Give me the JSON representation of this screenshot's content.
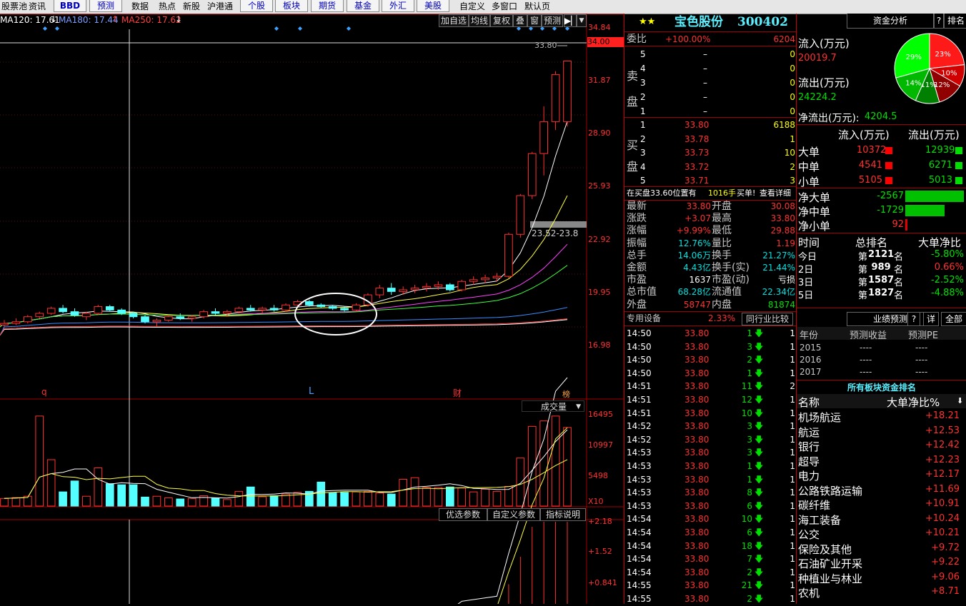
{
  "menu": {
    "items": [
      "股票池",
      "资讯"
    ],
    "tabs_blue": [
      "BBD",
      "预测"
    ],
    "items2": [
      "数据",
      "热点",
      "新股",
      "沪港通"
    ],
    "tabs2": [
      "个股",
      "板块",
      "期货",
      "基金",
      "外汇",
      "美股"
    ],
    "items3": [
      "自定义",
      "多窗口",
      "默认页"
    ]
  },
  "ma_labels": [
    {
      "text": "MA120: 17.61",
      "arrow": "↓",
      "color": "#ffffff"
    },
    {
      "text": "MA180: 17.44",
      "arrow": "↑",
      "color": "#7a9cff"
    },
    {
      "text": "MA250: 17.62",
      "arrow": "↓",
      "color": "#ff4040"
    }
  ],
  "toolbar": [
    "加自选",
    "均线",
    "复权",
    "叠",
    "窗",
    "预测"
  ],
  "price_axis": [
    "34.84",
    "34.00",
    "31.87",
    "28.90",
    "25.93",
    "22.92",
    "19.95",
    "16.98"
  ],
  "price_annot": {
    "high": "33.80",
    "range": "23.52-23.8"
  },
  "markers": {
    "q": "q",
    "L": "L",
    "cai": "财",
    "bang": "榜"
  },
  "volume": {
    "title": "成交量",
    "axis": [
      "16495",
      "10997",
      "5498",
      "X10"
    ]
  },
  "indicator": {
    "buttons": [
      "优选参数",
      "自定义参数",
      "指标说明"
    ],
    "axis": [
      "+2.18",
      "+1.52",
      "+0.841"
    ]
  },
  "chart_data": {
    "type": "candlestick",
    "price": {
      "ylim": [
        16.0,
        34.84
      ]
    },
    "candles": [
      [
        18.1,
        18.4,
        18.0,
        18.2
      ],
      [
        18.2,
        18.5,
        18.1,
        18.3
      ],
      [
        18.3,
        18.7,
        18.2,
        18.6
      ],
      [
        18.6,
        18.9,
        18.5,
        18.8
      ],
      [
        18.8,
        19.2,
        18.7,
        19.1
      ],
      [
        19.1,
        19.3,
        18.8,
        18.9
      ],
      [
        18.9,
        19.1,
        18.6,
        18.7
      ],
      [
        18.6,
        18.9,
        18.4,
        18.8
      ],
      [
        18.8,
        19.3,
        18.7,
        19.2
      ],
      [
        19.2,
        19.3,
        18.9,
        19.0
      ],
      [
        19.0,
        19.1,
        18.7,
        18.8
      ],
      [
        18.8,
        18.9,
        18.5,
        18.6
      ],
      [
        18.6,
        18.7,
        18.2,
        18.3
      ],
      [
        18.3,
        18.5,
        18.0,
        18.4
      ],
      [
        18.4,
        18.7,
        18.3,
        18.6
      ],
      [
        18.6,
        18.8,
        18.4,
        18.5
      ],
      [
        18.5,
        18.7,
        18.3,
        18.6
      ],
      [
        18.6,
        19.0,
        18.5,
        18.9
      ],
      [
        18.9,
        19.1,
        18.7,
        18.8
      ],
      [
        18.8,
        19.0,
        18.6,
        18.9
      ],
      [
        18.9,
        19.2,
        18.8,
        19.1
      ],
      [
        19.1,
        19.3,
        18.9,
        19.0
      ],
      [
        19.0,
        19.2,
        18.8,
        19.1
      ],
      [
        19.1,
        19.3,
        18.9,
        19.0
      ],
      [
        19.0,
        19.4,
        18.9,
        19.3
      ],
      [
        19.3,
        19.6,
        19.2,
        19.5
      ],
      [
        19.5,
        19.6,
        19.2,
        19.3
      ],
      [
        19.3,
        19.4,
        19.1,
        19.2
      ],
      [
        19.2,
        19.3,
        19.0,
        19.1
      ],
      [
        19.1,
        19.2,
        18.9,
        19.0
      ],
      [
        19.0,
        19.4,
        18.9,
        19.3
      ],
      [
        19.3,
        20.0,
        19.2,
        19.9
      ],
      [
        19.9,
        20.5,
        19.7,
        20.3
      ],
      [
        20.3,
        20.6,
        19.9,
        20.1
      ],
      [
        20.1,
        20.4,
        19.9,
        20.2
      ],
      [
        20.2,
        20.5,
        20.0,
        20.3
      ],
      [
        20.3,
        20.6,
        20.1,
        20.4
      ],
      [
        20.4,
        20.7,
        20.2,
        20.5
      ],
      [
        20.5,
        20.6,
        20.1,
        20.2
      ],
      [
        20.2,
        20.8,
        20.1,
        20.7
      ],
      [
        20.7,
        21.0,
        20.5,
        20.8
      ],
      [
        20.8,
        21.1,
        20.6,
        20.9
      ],
      [
        20.9,
        21.2,
        20.7,
        21.0
      ],
      [
        21.0,
        23.6,
        20.9,
        23.5
      ],
      [
        23.5,
        25.9,
        23.3,
        25.8
      ],
      [
        25.8,
        28.4,
        25.6,
        28.3
      ],
      [
        28.3,
        31.1,
        27.0,
        30.2
      ],
      [
        30.2,
        33.2,
        29.7,
        33.0
      ],
      [
        30.2,
        33.8,
        29.9,
        33.8
      ]
    ],
    "volumes": [
      1400,
      1550,
      1800,
      16495,
      8500,
      2600,
      4600,
      1800,
      7000,
      4100,
      3900,
      3900,
      1650,
      1800,
      1500,
      1300,
      1400,
      1900,
      1500,
      1200,
      2700,
      3500,
      1700,
      1900,
      2200,
      2500,
      2700,
      4400,
      2400,
      2500,
      2600,
      2700,
      2400,
      2200,
      4900,
      5200,
      3400,
      3400,
      3500,
      3300,
      2600,
      3100,
      2700,
      3600,
      8800,
      14600,
      15600,
      16495,
      14400
    ],
    "vol_ylim": [
      0,
      17000
    ]
  },
  "quote": {
    "star": "★★",
    "name": "宝色股份",
    "code": "300402",
    "weibi_label": "委比",
    "weibi_pct": "+100.00%",
    "weibi_val": "6204",
    "sell_label": "卖盘",
    "buy_label": "买盘",
    "sell": [
      {
        "n": "5",
        "p": "–",
        "v": "0"
      },
      {
        "n": "4",
        "p": "–",
        "v": "0"
      },
      {
        "n": "3",
        "p": "–",
        "v": "0"
      },
      {
        "n": "2",
        "p": "–",
        "v": "0"
      },
      {
        "n": "1",
        "p": "–",
        "v": "0"
      }
    ],
    "buy": [
      {
        "n": "1",
        "p": "33.80",
        "v": "6188"
      },
      {
        "n": "2",
        "p": "33.78",
        "v": "1"
      },
      {
        "n": "3",
        "p": "33.73",
        "v": "10"
      },
      {
        "n": "4",
        "p": "33.72",
        "v": "2"
      },
      {
        "n": "5",
        "p": "33.71",
        "v": "3"
      }
    ],
    "notice_a": "在买盘33.60位置有",
    "notice_b": "1016手",
    "notice_c": "买单!",
    "notice_d": "查看详细",
    "stats": [
      {
        "l": "最新",
        "v": "33.80",
        "vc": "red",
        "l2": "开盘",
        "v2": "30.08",
        "v2c": "red"
      },
      {
        "l": "涨跌",
        "v": "+3.07",
        "vc": "red",
        "l2": "最高",
        "v2": "33.80",
        "v2c": "red"
      },
      {
        "l": "涨幅",
        "v": "+9.99%",
        "vc": "red",
        "l2": "最低",
        "v2": "29.88",
        "v2c": "red"
      },
      {
        "l": "振幅",
        "v": "12.76%",
        "vc": "cyn",
        "l2": "量比",
        "v2": "1.19",
        "v2c": "red"
      },
      {
        "l": "总手",
        "v": "14.06万",
        "vc": "cyn",
        "l2": "换手",
        "v2": "21.27%",
        "v2c": "cyn"
      },
      {
        "l": "金额",
        "v": "4.43亿",
        "vc": "cyn",
        "l2": "换手(实)",
        "v2": "21.44%",
        "v2c": "cyn"
      },
      {
        "l": "市盈",
        "v": "1637",
        "vc": "wht",
        "l2": "市盈(动)",
        "v2": "亏损",
        "v2c": "wht"
      },
      {
        "l": "总市值",
        "v": "68.28亿",
        "vc": "cyn",
        "l2": "流通值",
        "v2": "22.34亿",
        "v2c": "cyn"
      },
      {
        "l": "外盘",
        "v": "58747",
        "vc": "red",
        "l2": "内盘",
        "v2": "81874",
        "v2c": "grn"
      }
    ],
    "equip_label": "专用设备",
    "equip_pct": "2.33%",
    "peer_btn": "同行业比较",
    "ticks": [
      {
        "t": "14:50",
        "p": "33.80",
        "v": "1",
        "c": "1"
      },
      {
        "t": "14:50",
        "p": "33.80",
        "v": "3",
        "c": "1"
      },
      {
        "t": "14:50",
        "p": "33.80",
        "v": "2",
        "c": "1"
      },
      {
        "t": "14:50",
        "p": "33.80",
        "v": "1",
        "c": "1"
      },
      {
        "t": "14:51",
        "p": "33.80",
        "v": "11",
        "c": "2"
      },
      {
        "t": "14:51",
        "p": "33.80",
        "v": "12",
        "c": "1"
      },
      {
        "t": "14:51",
        "p": "33.80",
        "v": "10",
        "c": "1"
      },
      {
        "t": "14:52",
        "p": "33.80",
        "v": "3",
        "c": "1"
      },
      {
        "t": "14:52",
        "p": "33.80",
        "v": "3",
        "c": "1"
      },
      {
        "t": "14:53",
        "p": "33.80",
        "v": "3",
        "c": "1"
      },
      {
        "t": "14:53",
        "p": "33.80",
        "v": "1",
        "c": "1"
      },
      {
        "t": "14:53",
        "p": "33.80",
        "v": "1",
        "c": "1"
      },
      {
        "t": "14:53",
        "p": "33.80",
        "v": "8",
        "c": "1"
      },
      {
        "t": "14:53",
        "p": "33.80",
        "v": "6",
        "c": "1"
      },
      {
        "t": "14:54",
        "p": "33.80",
        "v": "10",
        "c": "1"
      },
      {
        "t": "14:54",
        "p": "33.80",
        "v": "6",
        "c": "1"
      },
      {
        "t": "14:54",
        "p": "33.80",
        "v": "18",
        "c": "1"
      },
      {
        "t": "14:54",
        "p": "33.80",
        "v": "7",
        "c": "1"
      },
      {
        "t": "14:54",
        "p": "33.80",
        "v": "2",
        "c": "1"
      },
      {
        "t": "14:55",
        "p": "33.80",
        "v": "21",
        "c": "1"
      },
      {
        "t": "14:55",
        "p": "33.80",
        "v": "2",
        "c": "1"
      }
    ]
  },
  "capital": {
    "tab": "资金分析",
    "help": "?",
    "rank_tab": "排名",
    "inflow_label": "流入(万元)",
    "inflow": "20019.7",
    "outflow_label": "流出(万元)",
    "outflow": "24224.2",
    "net_label": "净流出(万元):",
    "net": "4204.5",
    "pie": [
      {
        "label": "23%",
        "value": 23,
        "color": "#ff1a1a"
      },
      {
        "label": "10%",
        "value": 10,
        "color": "#d00000"
      },
      {
        "label": "12%",
        "value": 12,
        "color": "#900000"
      },
      {
        "label": "11%",
        "value": 11,
        "color": "#008000"
      },
      {
        "label": "14%",
        "value": 14,
        "color": "#00b800"
      },
      {
        "label": "29%",
        "value": 29,
        "color": "#00ff00"
      }
    ],
    "flow_head": [
      "流入(万元)",
      "流出(万元)"
    ],
    "flows": [
      {
        "l": "大单",
        "in": "10372",
        "out": "12939"
      },
      {
        "l": "中单",
        "in": "4541",
        "out": "6271"
      },
      {
        "l": "小单",
        "in": "5105",
        "out": "5013"
      }
    ],
    "nets": [
      {
        "l": "净大单",
        "v": "-2567",
        "pct": 1.0,
        "c": "#00c000"
      },
      {
        "l": "净中单",
        "v": "-1729",
        "pct": 0.67,
        "c": "#00c000"
      },
      {
        "l": "净小单",
        "v": "92",
        "pct": 0.04,
        "c": "#e00000"
      }
    ],
    "rank_head": [
      "时间",
      "总排名",
      "大单净比"
    ],
    "ranks": [
      {
        "t": "今日",
        "pre": "第",
        "n": "2121",
        "suf": "名",
        "v": "-5.80%",
        "c": "grn"
      },
      {
        "t": "2日",
        "pre": "第",
        "n": " 989",
        "suf": "名",
        "v": "0.66%",
        "c": "red"
      },
      {
        "t": "3日",
        "pre": "第",
        "n": "1587",
        "suf": "名",
        "v": "-2.52%",
        "c": "grn"
      },
      {
        "t": "5日",
        "pre": "第",
        "n": "1827",
        "suf": "名",
        "v": "-4.88%",
        "c": "grn"
      }
    ],
    "forecast_tab": "业绩预测",
    "forecast_btns": [
      "?",
      "详",
      "全部"
    ],
    "forecast_head": [
      "年份",
      "预测收益",
      "预测PE"
    ],
    "forecast": [
      {
        "y": "2015",
        "e": "----",
        "pe": "----"
      },
      {
        "y": "2016",
        "e": "----",
        "pe": "----"
      },
      {
        "y": "2017",
        "e": "----",
        "pe": "----"
      }
    ],
    "sector_title": "所有板块资金排名",
    "sector_head": [
      "名称",
      "大单净比%"
    ],
    "sectors": [
      {
        "n": "机场航运",
        "v": "+18.21"
      },
      {
        "n": "航运",
        "v": "+12.53"
      },
      {
        "n": "银行",
        "v": "+12.42"
      },
      {
        "n": "超导",
        "v": "+12.23"
      },
      {
        "n": "电力",
        "v": "+12.17"
      },
      {
        "n": "公路铁路运输",
        "v": "+11.69"
      },
      {
        "n": "碳纤维",
        "v": "+10.91"
      },
      {
        "n": "海工装备",
        "v": "+10.24"
      },
      {
        "n": "公交",
        "v": "+10.21"
      },
      {
        "n": "保险及其他",
        "v": "+9.72"
      },
      {
        "n": "石油矿业开采",
        "v": "+9.22"
      },
      {
        "n": "种植业与林业",
        "v": "+9.06"
      },
      {
        "n": "农机",
        "v": "+8.71"
      }
    ]
  }
}
